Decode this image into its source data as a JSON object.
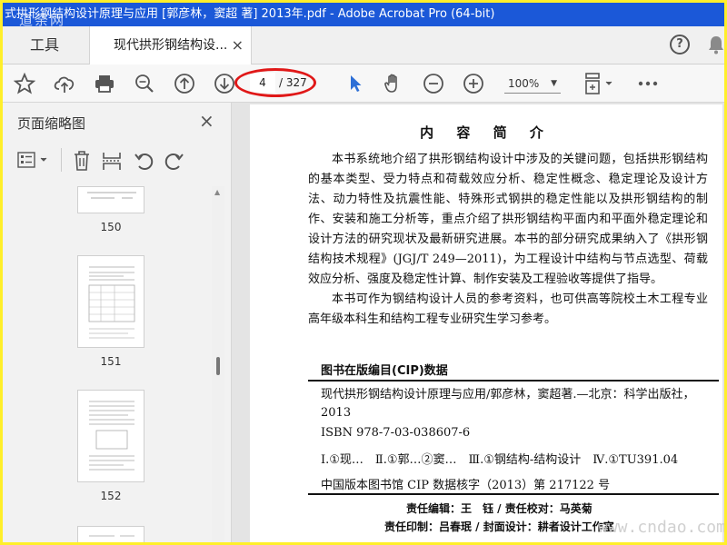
{
  "window": {
    "title": "式拱形钢结构设计原理与应用 [郭彦林，窦超 著] 2013年.pdf - Adobe Acrobat Pro (64-bit)",
    "watermark_logo": "道荼网"
  },
  "tabs": {
    "tools_label": "工具",
    "doc_label": "现代拱形钢结构设...",
    "close_glyph": "×"
  },
  "toolbar": {
    "current_page": "4",
    "total_pages": "/ 327",
    "zoom": "100%"
  },
  "panel": {
    "title": "页面缩略图",
    "close_glyph": "×",
    "thumbnails": [
      "150",
      "151",
      "152"
    ]
  },
  "document": {
    "heading": "内 容 简 介",
    "paragraph1": "本书系统地介绍了拱形钢结构设计中涉及的关键问题，包括拱形钢结构的基本类型、受力特点和荷载效应分析、稳定性概念、稳定理论及设计方法、动力特性及抗震性能、特殊形式钢拱的稳定性能以及拱形钢结构的制作、安装和施工分析等，重点介绍了拱形钢结构平面内和平面外稳定理论和设计方法的研究现状及最新研究进展。本书的部分研究成果纳入了《拱形钢结构技术规程》(JGJ/T 249—2011)，为工程设计中结构与节点选型、荷载效应分析、强度及稳定性计算、制作安装及工程验收等提供了指导。",
    "paragraph2": "本书可作为钢结构设计人员的参考资料，也可供高等院校土木工程专业高年级本科生和结构工程专业研究生学习参考。",
    "cip_title": "图书在版编目(CIP)数据",
    "cip_entry": "现代拱形钢结构设计原理与应用/郭彦林，窦超著.—北京：科学出版社，2013",
    "isbn": "ISBN 978-7-03-038607-6",
    "classification": "Ⅰ.①现…　Ⅱ.①郭…②窦…　Ⅲ.①钢结构-结构设计　Ⅳ.①TU391.04",
    "cip_number": "中国版本图书馆 CIP 数据核字（2013）第 217122 号",
    "credit1": "责任编辑：王　钰 / 责任校对：马英菊",
    "credit2": "责任印制：吕春珉 / 封面设计：耕者设计工作室",
    "site_watermark": "www.cndao.com"
  }
}
